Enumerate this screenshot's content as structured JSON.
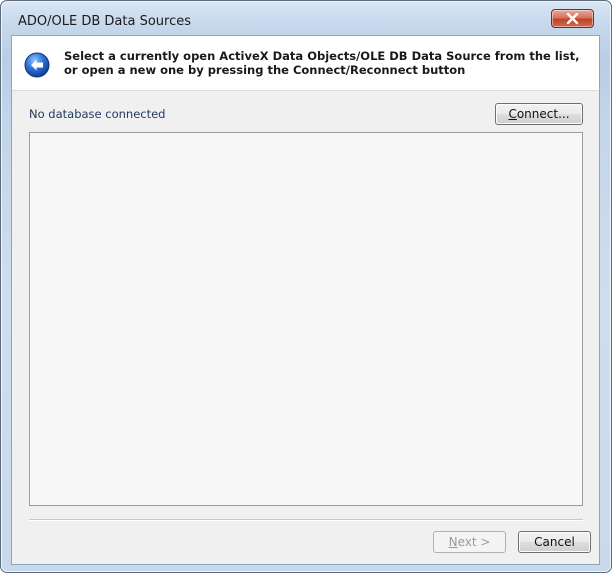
{
  "window": {
    "title": "ADO/OLE DB Data Sources"
  },
  "header": {
    "instruction": "Select a currently open ActiveX Data Objects/OLE DB Data Source from the list, or open a new one by pressing the Connect/Reconnect button",
    "back_icon": "back-arrow-icon"
  },
  "content": {
    "status": "No database connected",
    "connect_label_prefix": "C",
    "connect_label_rest": "onnect...",
    "list_items": []
  },
  "footer": {
    "next_label_prefix": "N",
    "next_label_rest": "ext >",
    "cancel_label": "Cancel"
  },
  "colors": {
    "close_button": "#c0432b",
    "status_text": "#1e395b",
    "back_icon": "#2a6fd6"
  }
}
